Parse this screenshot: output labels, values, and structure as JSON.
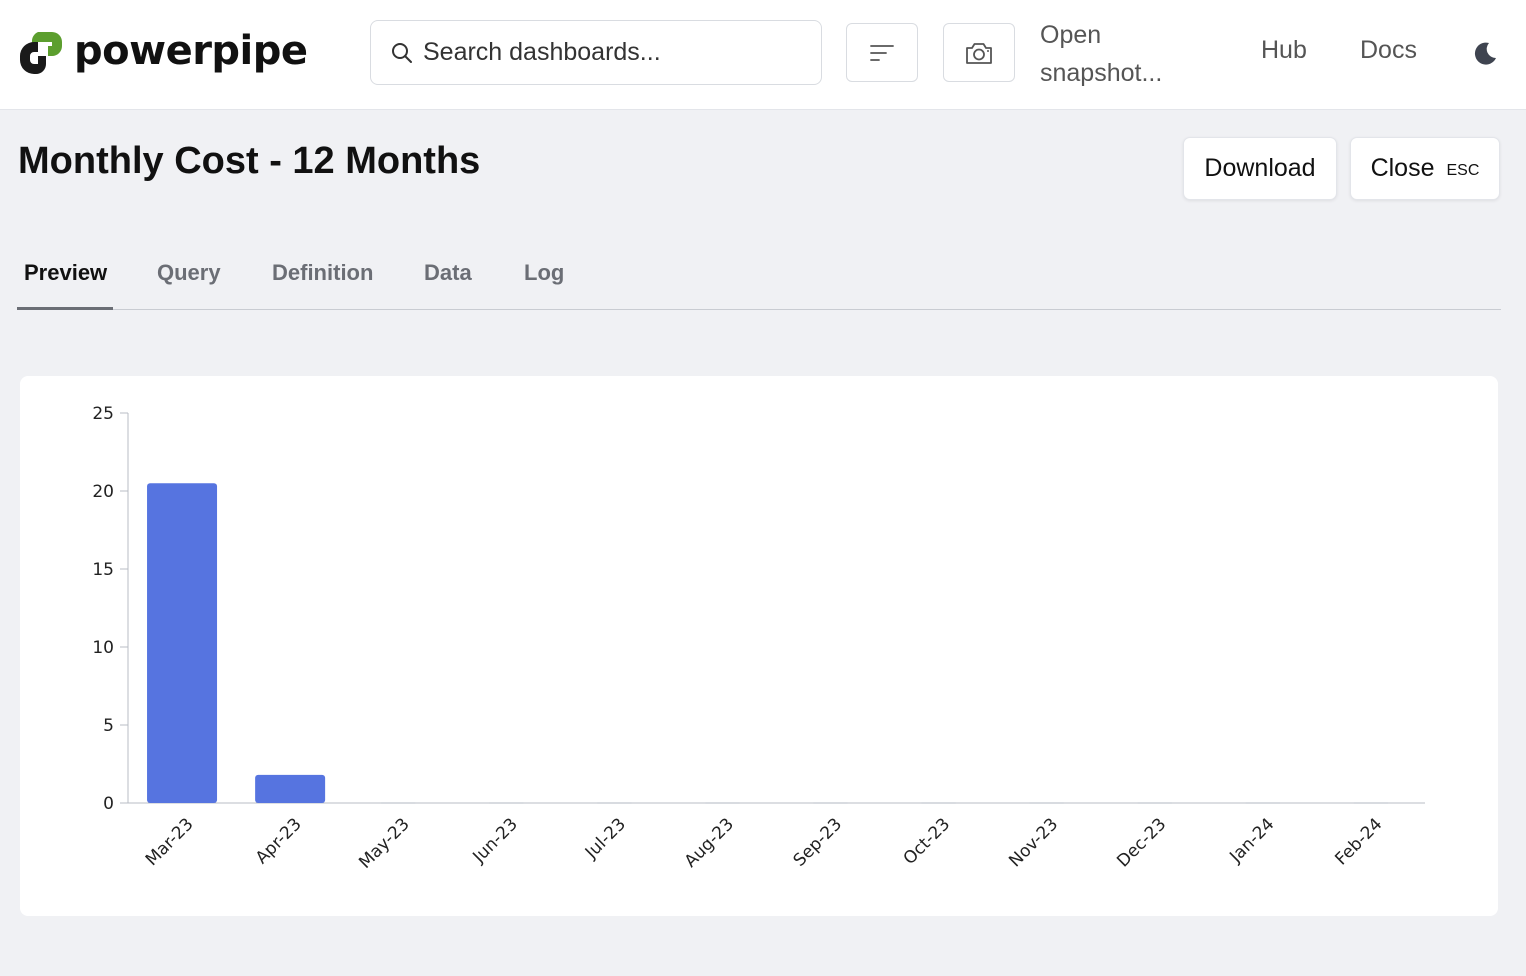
{
  "app": {
    "name": "powerpipe",
    "brand_color": "#5c9e2e"
  },
  "header": {
    "search_placeholder": "Search dashboards...",
    "open_snapshot": "Open snapshot...",
    "hub": "Hub",
    "docs": "Docs",
    "icons": [
      "search-icon",
      "filter-icon",
      "camera-icon",
      "moon-icon"
    ]
  },
  "panel": {
    "title": "Monthly Cost - 12 Months",
    "download_label": "Download",
    "close_label": "Close",
    "close_shortcut": "ESC"
  },
  "tabs": [
    {
      "label": "Preview",
      "active": true
    },
    {
      "label": "Query",
      "active": false
    },
    {
      "label": "Definition",
      "active": false
    },
    {
      "label": "Data",
      "active": false
    },
    {
      "label": "Log",
      "active": false
    }
  ],
  "chart_data": {
    "type": "bar",
    "categories": [
      "Mar-23",
      "Apr-23",
      "May-23",
      "Jun-23",
      "Jul-23",
      "Aug-23",
      "Sep-23",
      "Oct-23",
      "Nov-23",
      "Dec-23",
      "Jan-24",
      "Feb-24"
    ],
    "values": [
      20.5,
      1.8,
      0,
      0,
      0,
      0,
      0,
      0,
      0,
      0,
      0,
      0
    ],
    "ylim": [
      0,
      25
    ],
    "yticks": [
      0,
      5,
      10,
      15,
      20,
      25
    ],
    "bar_color": "#5674e0",
    "title": "",
    "xlabel": "",
    "ylabel": "",
    "legend": false,
    "grid": false
  }
}
